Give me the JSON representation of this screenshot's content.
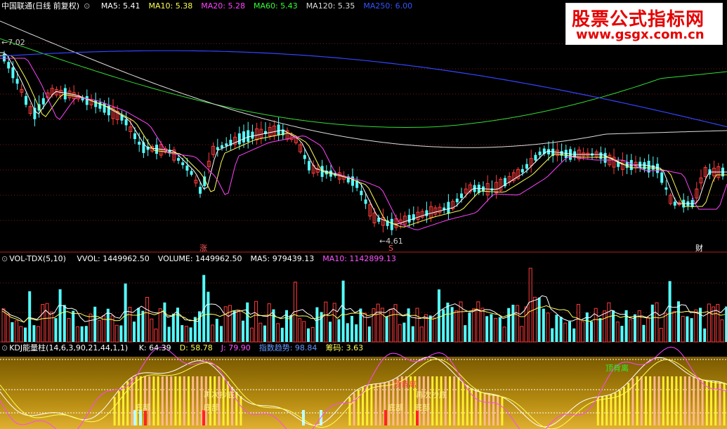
{
  "main": {
    "stock_label": "中国联通(日线 前复权)",
    "ma": [
      {
        "label": "MA5: 5.41",
        "color": "#ffffff"
      },
      {
        "label": "MA10: 5.38",
        "color": "#ffff55"
      },
      {
        "label": "MA20: 5.28",
        "color": "#ff44ff"
      },
      {
        "label": "MA60: 5.43",
        "color": "#33ff33"
      },
      {
        "label": "MA120: 5.35",
        "color": "#dddddd"
      },
      {
        "label": "MA250: 6.00",
        "color": "#3355ff"
      }
    ],
    "high_label": "7.02",
    "low_label": "4.61",
    "markers": [
      "涨",
      "S",
      "财"
    ]
  },
  "watermark": {
    "title": "股票公式指标网",
    "url": "www.gsgx.com.cn"
  },
  "volume": {
    "title": "VOL-TDX(5,10)",
    "items": [
      {
        "label": "VVOL: 1449962.50",
        "color": "#ffffff"
      },
      {
        "label": "VOLUME: 1449962.50",
        "color": "#ffffff"
      },
      {
        "label": "MA5: 979439.13",
        "color": "#ffffff"
      },
      {
        "label": "MA10: 1142899.13",
        "color": "#ff55ff"
      }
    ]
  },
  "kdj": {
    "title": "KDJ能量柱(14,6,3,90,21,44,1,1)",
    "items": [
      {
        "label": "K: 64.39",
        "color": "#ffffff"
      },
      {
        "label": "D: 58.78",
        "color": "#ffff55"
      },
      {
        "label": "J: 79.90",
        "color": "#ff55ff"
      },
      {
        "label": "指数趋势: 98.84",
        "color": "#6699ff"
      },
      {
        "label": "筹码: 3.63",
        "color": "#ffff55"
      }
    ],
    "annotations": [
      "底部",
      "再次抄底",
      "底部",
      "顶背离",
      "底部",
      "再次抄底",
      "顶背离",
      "底部"
    ]
  }
}
